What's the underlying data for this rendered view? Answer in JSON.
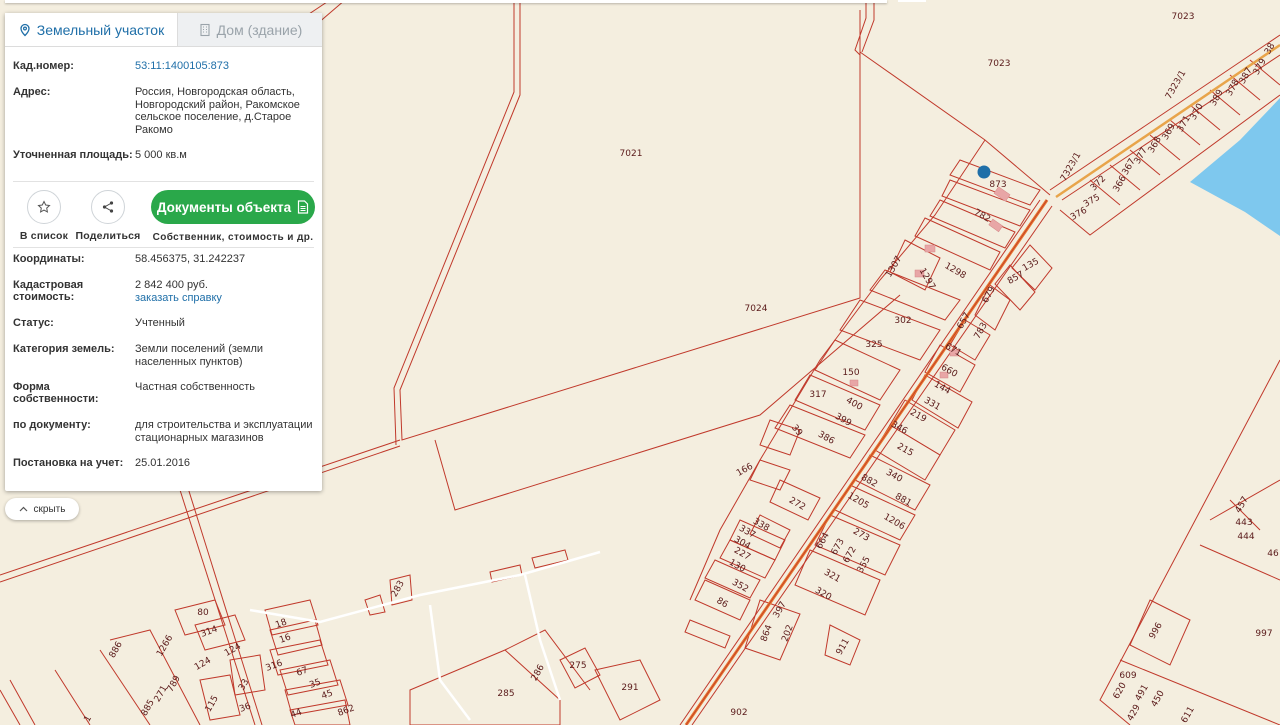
{
  "map": {
    "labels": [
      {
        "t": "7023"
      },
      {
        "t": "7023"
      },
      {
        "t": "7021"
      },
      {
        "t": "7024"
      },
      {
        "t": "873"
      },
      {
        "t": "782"
      },
      {
        "t": "1307"
      },
      {
        "t": "1297"
      },
      {
        "t": "1298"
      },
      {
        "t": "302"
      },
      {
        "t": "325"
      },
      {
        "t": "150"
      },
      {
        "t": "317"
      },
      {
        "t": "400"
      },
      {
        "t": "399"
      },
      {
        "t": "39"
      },
      {
        "t": "386"
      },
      {
        "t": "166"
      },
      {
        "t": "272"
      },
      {
        "t": "338"
      },
      {
        "t": "337"
      },
      {
        "t": "304"
      },
      {
        "t": "227"
      },
      {
        "t": "130"
      },
      {
        "t": "352"
      },
      {
        "t": "86"
      },
      {
        "t": "397"
      },
      {
        "t": "864"
      },
      {
        "t": "202"
      },
      {
        "t": "320"
      },
      {
        "t": "321"
      },
      {
        "t": "355"
      },
      {
        "t": "672"
      },
      {
        "t": "673"
      },
      {
        "t": "664"
      },
      {
        "t": "273"
      },
      {
        "t": "1205"
      },
      {
        "t": "1206"
      },
      {
        "t": "881"
      },
      {
        "t": "882"
      },
      {
        "t": "340"
      },
      {
        "t": "215"
      },
      {
        "t": "346"
      },
      {
        "t": "219"
      },
      {
        "t": "331"
      },
      {
        "t": "144"
      },
      {
        "t": "660"
      },
      {
        "t": "671"
      },
      {
        "t": "783"
      },
      {
        "t": "657"
      },
      {
        "t": "679"
      },
      {
        "t": "857"
      },
      {
        "t": "135"
      },
      {
        "t": "7323/1"
      },
      {
        "t": "7323/1"
      },
      {
        "t": "376"
      },
      {
        "t": "375"
      },
      {
        "t": "372"
      },
      {
        "t": "366"
      },
      {
        "t": "367"
      },
      {
        "t": "377"
      },
      {
        "t": "368"
      },
      {
        "t": "369"
      },
      {
        "t": "371"
      },
      {
        "t": "370"
      },
      {
        "t": "389"
      },
      {
        "t": "378"
      },
      {
        "t": "387"
      },
      {
        "t": "379"
      },
      {
        "t": "38"
      },
      {
        "t": "911"
      },
      {
        "t": "902"
      },
      {
        "t": "996"
      },
      {
        "t": "997"
      },
      {
        "t": "457"
      },
      {
        "t": "443"
      },
      {
        "t": "444"
      },
      {
        "t": "46"
      },
      {
        "t": "609"
      },
      {
        "t": "491"
      },
      {
        "t": "450"
      },
      {
        "t": "429"
      },
      {
        "t": "620"
      },
      {
        "t": "611"
      },
      {
        "t": "283"
      },
      {
        "t": "285"
      },
      {
        "t": "286"
      },
      {
        "t": "275"
      },
      {
        "t": "291"
      },
      {
        "t": "80"
      },
      {
        "t": "314"
      },
      {
        "t": "18"
      },
      {
        "t": "16"
      },
      {
        "t": "124"
      },
      {
        "t": "124"
      },
      {
        "t": "316"
      },
      {
        "t": "67"
      },
      {
        "t": "35"
      },
      {
        "t": "45"
      },
      {
        "t": "862"
      },
      {
        "t": "44"
      },
      {
        "t": "36"
      },
      {
        "t": "33"
      },
      {
        "t": "115"
      },
      {
        "t": "789"
      },
      {
        "t": "271"
      },
      {
        "t": "1266"
      },
      {
        "t": "886"
      },
      {
        "t": "885"
      },
      {
        "t": "1"
      }
    ]
  },
  "panel": {
    "tabs": {
      "land": "Земельный участок",
      "building": "Дом (здание)"
    },
    "top": [
      {
        "k": "Кад.номер:",
        "v": "53:11:1400105:873",
        "link": true
      },
      {
        "k": "Адрес:",
        "v": "Россия, Новгородская область, Новгородский район, Ракомское сельское поселение, д.Старое Ракомо"
      },
      {
        "k": "Уточненная площадь:",
        "v": "5 000 кв.м"
      }
    ],
    "actions": {
      "fav": "В список",
      "share": "Поделиться",
      "docs": "Документы объекта",
      "docs_caption": "Собственник, стоимость и др."
    },
    "bottom": [
      {
        "k": "Координаты:",
        "v": "58.456375, 31.242237"
      },
      {
        "k": "Кадастровая стоимость:",
        "v": "2 842 400 руб.",
        "extra": "заказать справку"
      },
      {
        "k": "Статус:",
        "v": "Учтенный"
      },
      {
        "k": "Категория земель:",
        "v": "Земли поселений (земли населенных пунктов)"
      },
      {
        "k": "Форма собственности:",
        "v": "Частная собственность"
      },
      {
        "k": "по документу:",
        "v": "для строительства и эксплуатации стационарных магазинов"
      },
      {
        "k": "Постановка на учет:",
        "v": "25.01.2016"
      }
    ]
  },
  "hide_label": "скрыть",
  "colors": {
    "parcel": "#c0392b",
    "road": "#e8772e",
    "water": "#7ec8ee",
    "marker": "#1f6fa8",
    "green": "#2aa84a"
  }
}
